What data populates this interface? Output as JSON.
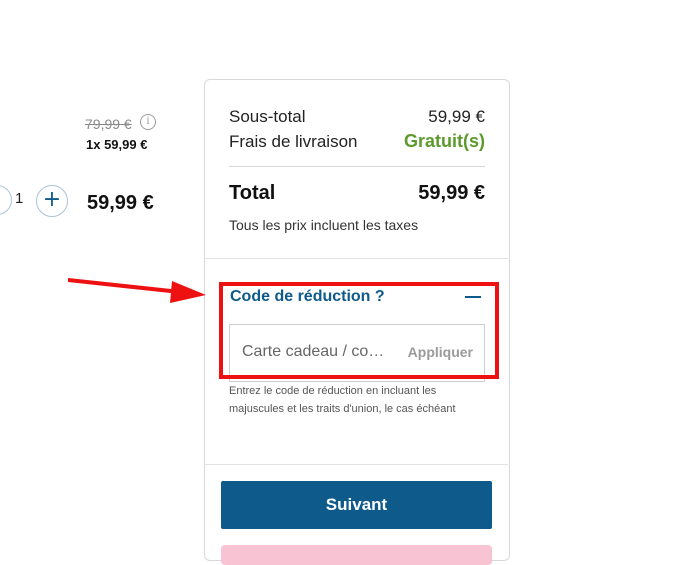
{
  "product": {
    "old_price": "79,99 €",
    "info_icon": "i",
    "unit_line": "1x 59,99 €",
    "quantity": "1",
    "plus_icon": "+",
    "line_total": "59,99 €"
  },
  "summary": {
    "subtotal_label": "Sous-total",
    "subtotal_value": "59,99 €",
    "shipping_label": "Frais de livraison",
    "shipping_value": "Gratuit(s)",
    "total_label": "Total",
    "total_value": "59,99 €",
    "tax_note": "Tous les prix incluent les taxes"
  },
  "discount": {
    "title": "Code de réduction ?",
    "placeholder": "Carte cadeau / code de réduction",
    "apply_label": "Appliquer",
    "help": "Entrez le code de réduction en incluant les majuscules et les traits d'union, le cas échéant"
  },
  "actions": {
    "next_label": "Suivant"
  },
  "colors": {
    "accent": "#0e5a8a",
    "free_shipping": "#5c9a2c",
    "annotation": "#ee1111"
  }
}
